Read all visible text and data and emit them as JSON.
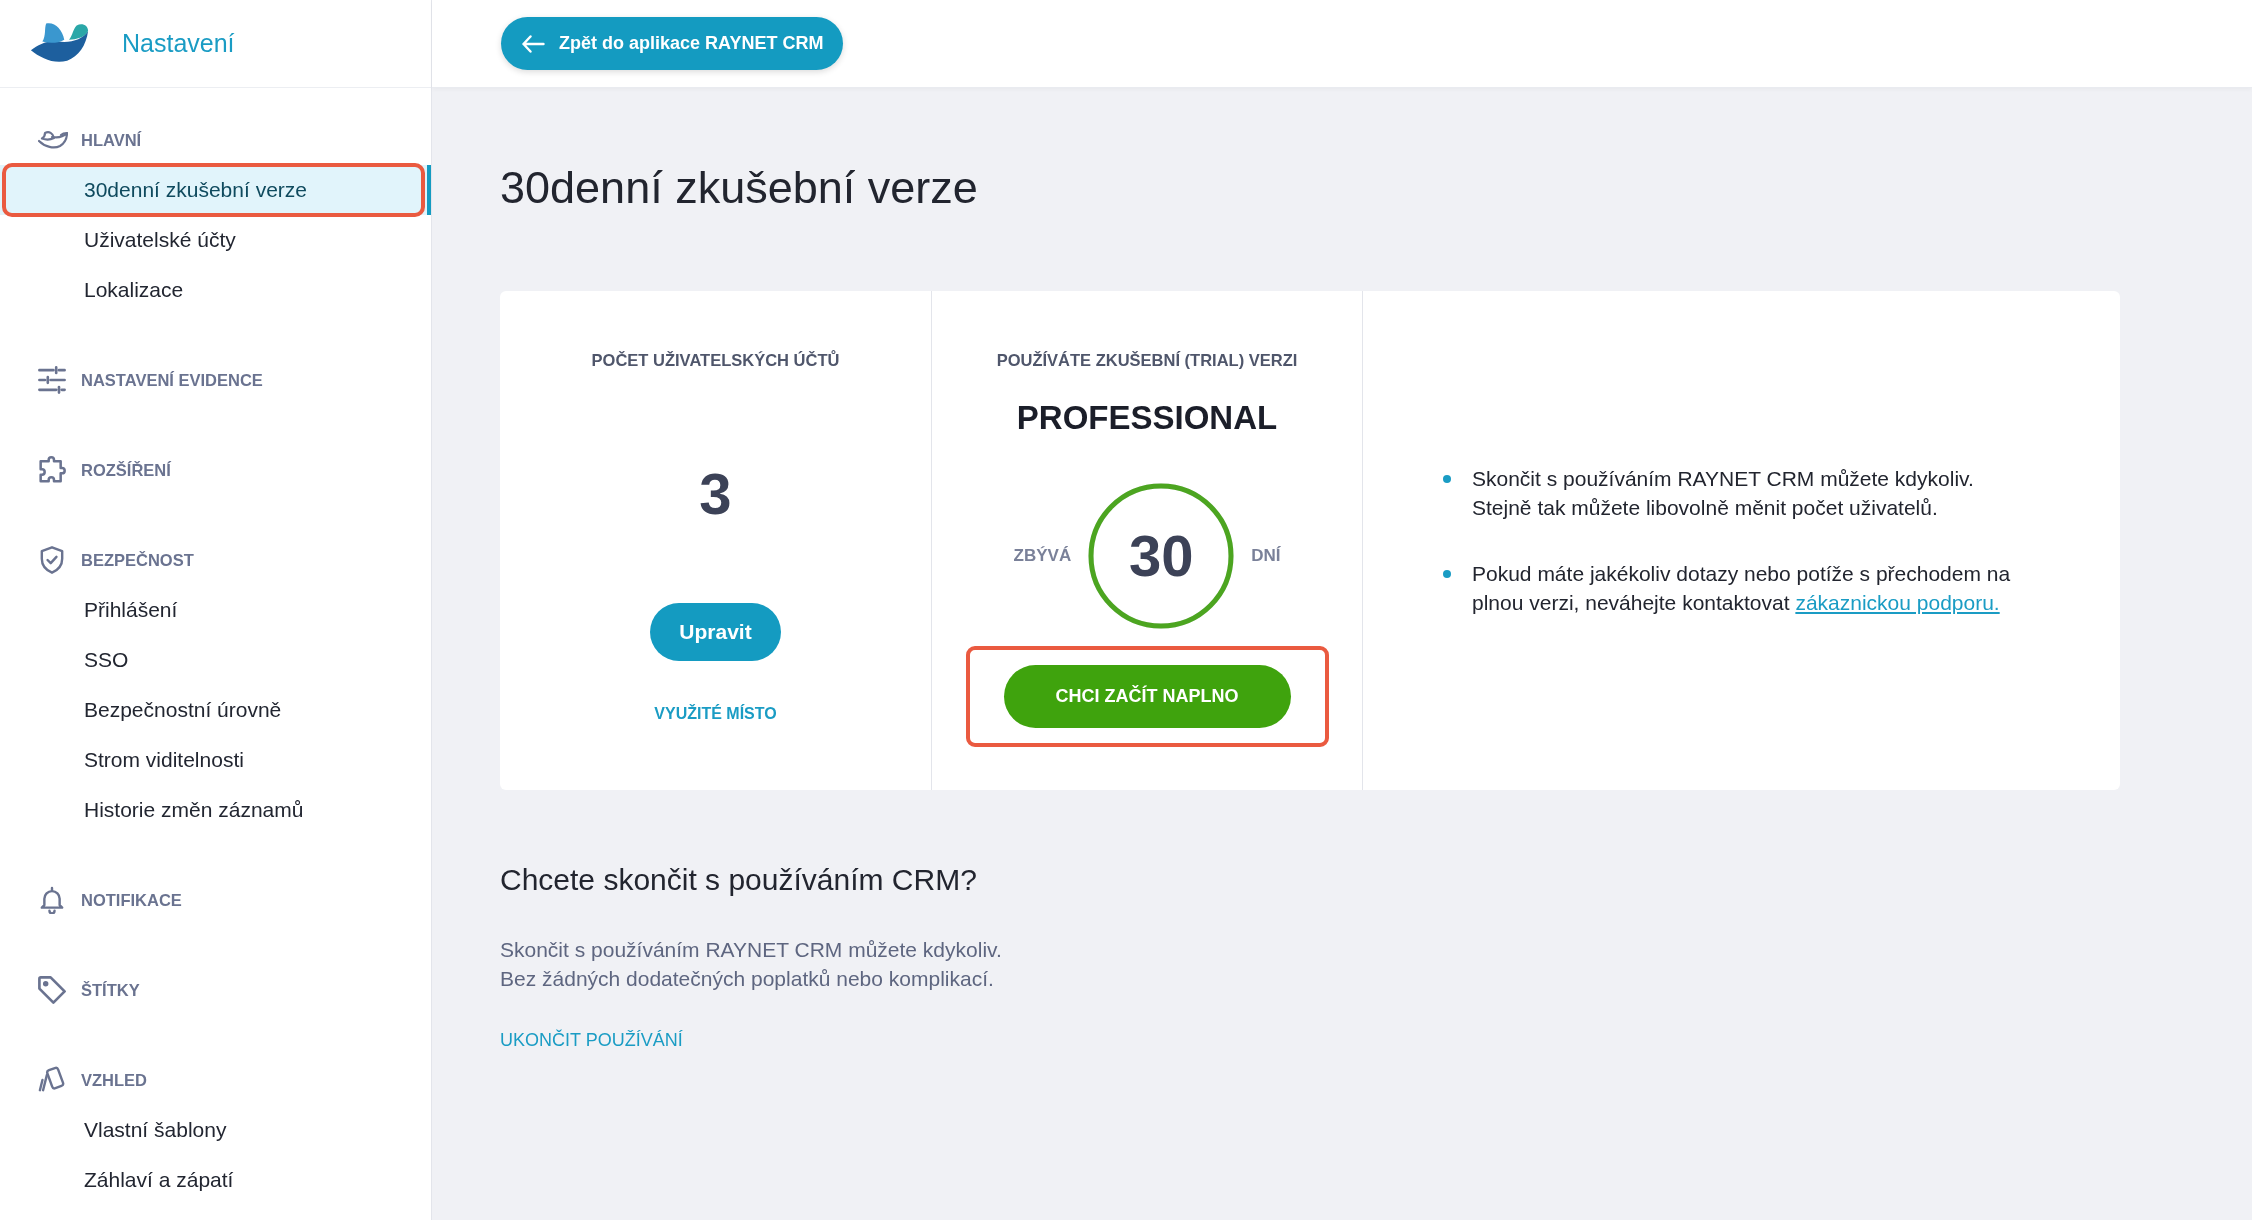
{
  "sidebar": {
    "title": "Nastavení",
    "sections": [
      {
        "label": "HLAVNÍ",
        "items": [
          {
            "label": "30denní zkušební verze",
            "selected": true,
            "outlined": true
          },
          {
            "label": "Uživatelské účty",
            "selected": false,
            "outlined": false
          },
          {
            "label": "Lokalizace",
            "selected": false,
            "outlined": false
          }
        ]
      },
      {
        "label": "NASTAVENÍ EVIDENCE"
      },
      {
        "label": "ROZŠÍŘENÍ"
      },
      {
        "label": "BEZPEČNOST",
        "items": [
          {
            "label": "Přihlášení",
            "selected": false,
            "outlined": false
          },
          {
            "label": "SSO",
            "selected": false,
            "outlined": false
          },
          {
            "label": "Bezpečnostní úrovně",
            "selected": false,
            "outlined": false
          },
          {
            "label": "Strom viditelnosti",
            "selected": false,
            "outlined": false
          },
          {
            "label": "Historie změn záznamů",
            "selected": false,
            "outlined": false
          }
        ]
      },
      {
        "label": "NOTIFIKACE"
      },
      {
        "label": "ŠTÍTKY"
      },
      {
        "label": "VZHLED",
        "items": [
          {
            "label": "Vlastní šablony",
            "selected": false,
            "outlined": false
          },
          {
            "label": "Záhlaví a zápatí",
            "selected": false,
            "outlined": false
          }
        ]
      }
    ]
  },
  "top_bar": {
    "back_button": "Zpět do aplikace RAYNET CRM"
  },
  "page_title": "30denní zkušební verze",
  "trial_card": {
    "accounts": {
      "heading": "POČET UŽIVATELSKÝCH ÚČTŮ",
      "count": "3",
      "edit_button": "Upravit",
      "usage_link": "VYUŽITÉ MÍSTO"
    },
    "plan": {
      "heading": "POUŽÍVÁTE ZKUŠEBNÍ (TRIAL) VERZI",
      "name": "PROFESSIONAL",
      "remaining_label": "ZBÝVÁ",
      "days": "30",
      "days_label": "DNÍ",
      "level": 1,
      "upgrade_button": {
        "label": "CHCI ZAČÍT NAPLNO",
        "outlined": true
      }
    },
    "notes": [
      {
        "text": "Skončit s používáním RAYNET CRM můžete kdykoliv.\nStejně tak můžete libovolně měnit počet uživatelů."
      },
      {
        "text": "Pokud máte jakékoliv dotazy nebo potíže s přechodem na\nplnou verzi, neváhejte kontaktovat ",
        "link": "zákaznickou podporu."
      }
    ]
  },
  "cancel_section": {
    "title": "Chcete skončit s používáním CRM?",
    "text": "Skončit s používáním RAYNET CRM můžete kdykoliv.\nBez žádných dodatečných poplatků nebo komplikací.",
    "link": "UKONČIT POUŽÍVÁNÍ"
  }
}
